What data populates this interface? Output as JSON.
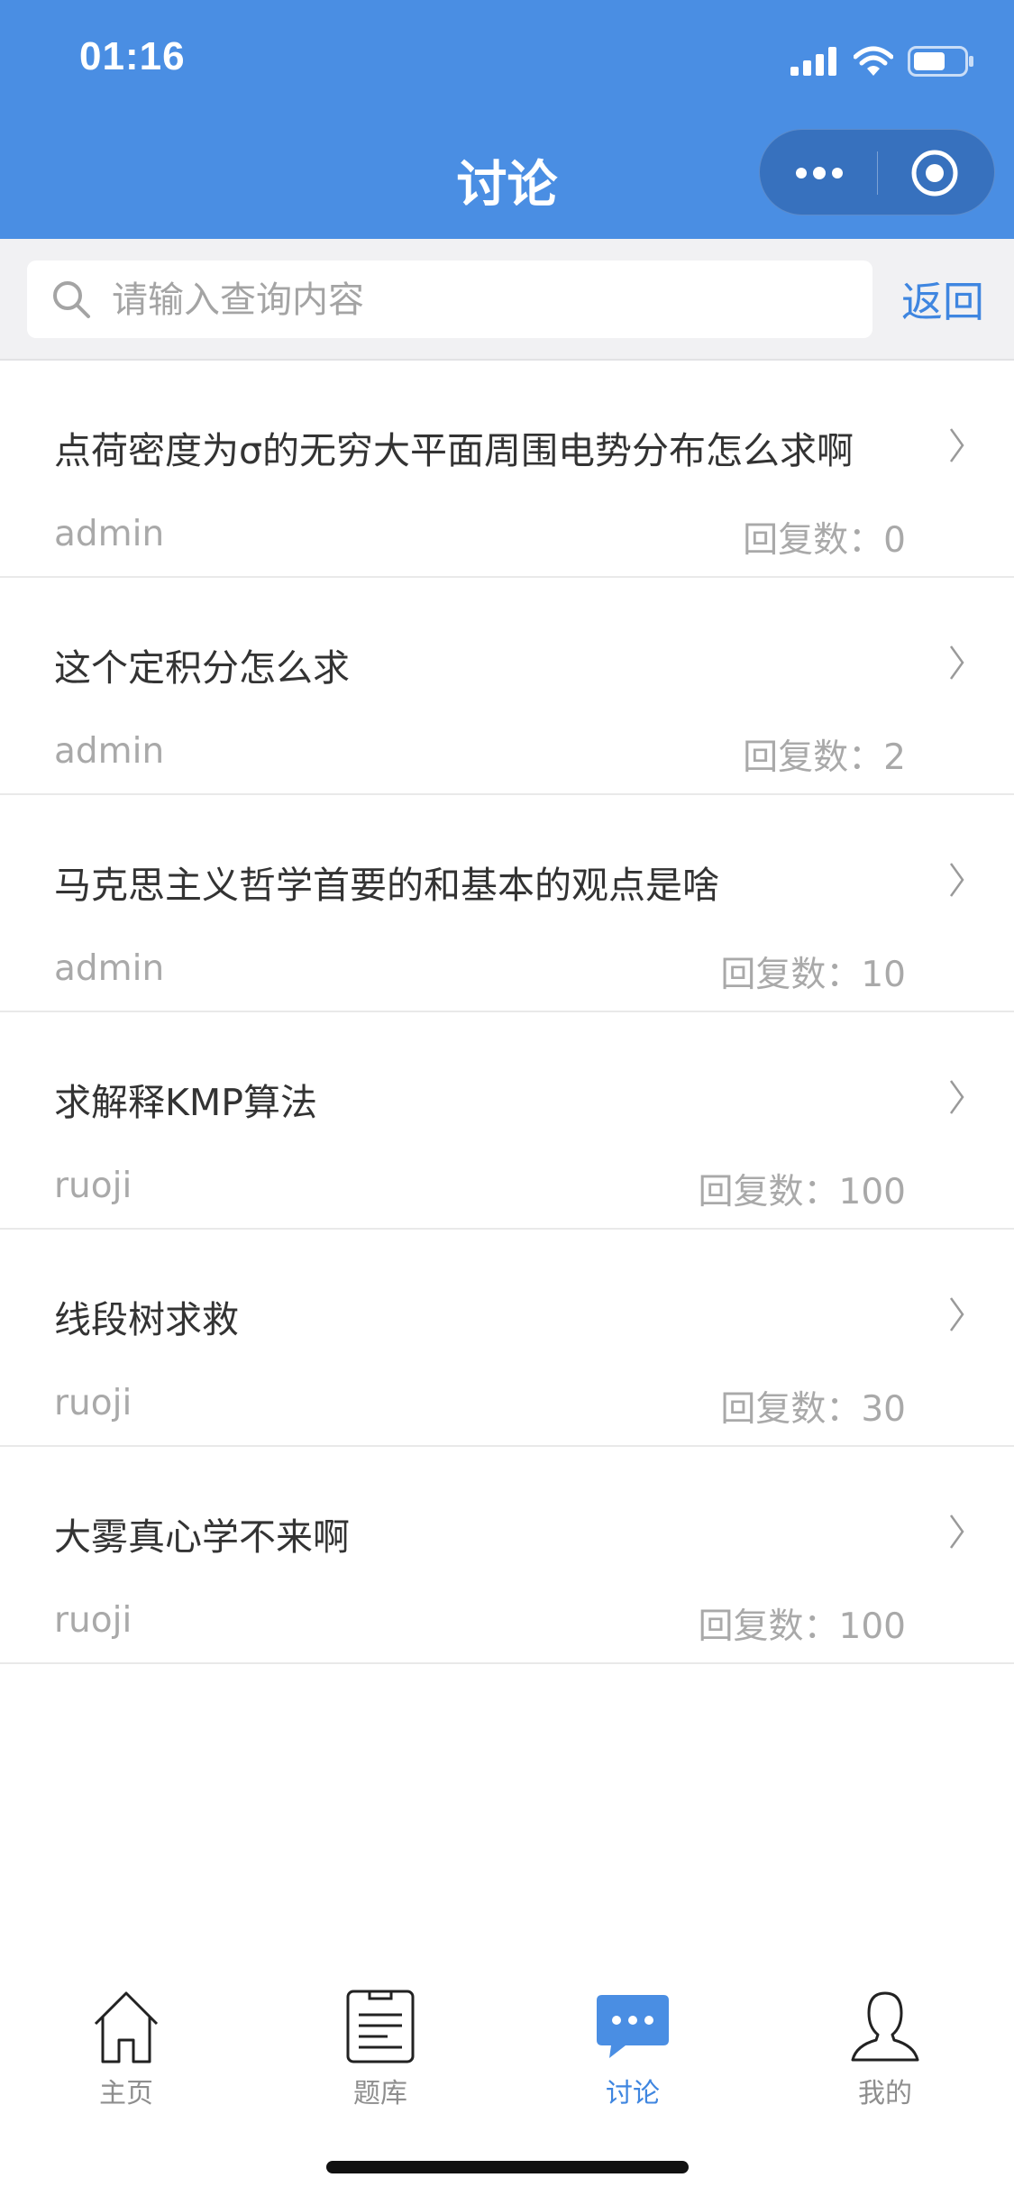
{
  "status_bar": {
    "time": "01:16"
  },
  "header": {
    "title": "讨论"
  },
  "search": {
    "placeholder": "请输入查询内容",
    "back_label": "返回"
  },
  "discussions": [
    {
      "title": "点荷密度为σ的无穷大平面周围电势分布怎么求啊",
      "author": "admin",
      "replies": "回复数：0"
    },
    {
      "title": "这个定积分怎么求",
      "author": "admin",
      "replies": "回复数：2"
    },
    {
      "title": "马克思主义哲学首要的和基本的观点是啥",
      "author": "admin",
      "replies": "回复数：10"
    },
    {
      "title": "求解释KMP算法",
      "author": "ruoji",
      "replies": "回复数：100"
    },
    {
      "title": "线段树求救",
      "author": "ruoji",
      "replies": "回复数：30"
    },
    {
      "title": "大雾真心学不来啊",
      "author": "ruoji",
      "replies": "回复数：100"
    }
  ],
  "tabbar": {
    "home": "主页",
    "questions": "题库",
    "discuss": "讨论",
    "mine": "我的"
  },
  "colors": {
    "accent": "#4a8ee3",
    "link": "#3f86e0"
  }
}
